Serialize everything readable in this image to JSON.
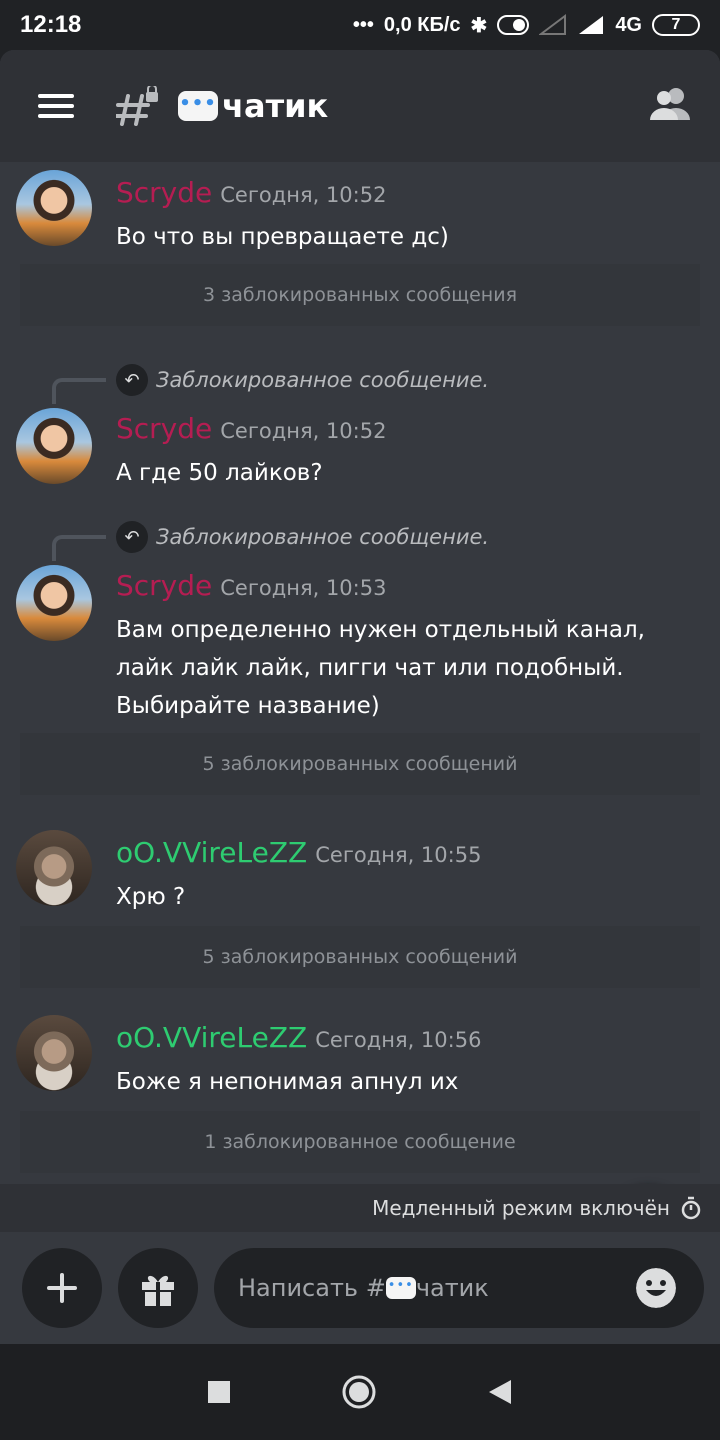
{
  "status_bar": {
    "time": "12:18",
    "network_speed": "0,0 КБ/с",
    "network_type": "4G",
    "battery": "7"
  },
  "header": {
    "channel_name": "чатик",
    "icons": [
      "menu-icon",
      "locked-channel-icon",
      "members-icon"
    ]
  },
  "messages": [
    {
      "author": "Scryde",
      "author_color": "#b51d52",
      "timestamp": "Сегодня, 10:52",
      "text": "Во что вы превращаете дс)",
      "blocked_notice": "3 заблокированных сообщения"
    },
    {
      "reply_to": "Заблокированное сообщение.",
      "author": "Scryde",
      "author_color": "#b51d52",
      "timestamp": "Сегодня, 10:52",
      "text": "А где 50 лайков?"
    },
    {
      "reply_to": "Заблокированное сообщение.",
      "author": "Scryde",
      "author_color": "#b51d52",
      "timestamp": "Сегодня, 10:53",
      "text": "Вам определенно нужен отдельный канал, лайк лайк лайк, пигги чат или подобный. Выбирайте название)",
      "blocked_notice": "5 заблокированных сообщений"
    },
    {
      "author": "oO.VVireLeZZ",
      "author_color": "#2ecc71",
      "timestamp": "Сегодня, 10:55",
      "text": "Хрю ?",
      "blocked_notice": "5 заблокированных сообщений"
    },
    {
      "author": "oO.VVireLeZZ",
      "author_color": "#2ecc71",
      "timestamp": "Сегодня, 10:56",
      "text": "Боже я непонимая апнул их",
      "blocked_notice": "1 заблокированное сообщение"
    }
  ],
  "slow_mode": {
    "label": "Медленный режим включён"
  },
  "composer": {
    "placeholder_prefix": "Написать #",
    "placeholder_channel": "чатик"
  }
}
